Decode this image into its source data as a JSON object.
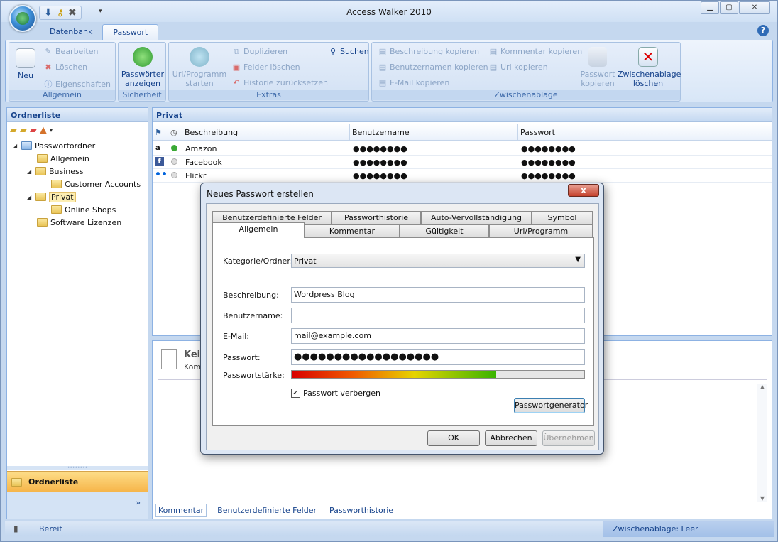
{
  "window": {
    "title": "Access Walker 2010"
  },
  "ribbon": {
    "tabs": [
      "Datenbank",
      "Passwort"
    ],
    "help": "?",
    "allgemein": {
      "neu": "Neu",
      "bearbeiten": "Bearbeiten",
      "loeschen": "Löschen",
      "eigenschaften": "Eigenschaften",
      "caption": "Allgemein"
    },
    "sicherheit": {
      "show_pw": "Passwörter anzeigen",
      "caption": "Sicherheit"
    },
    "extras": {
      "url_start": "Url/Programm starten",
      "duplizieren": "Duplizieren",
      "felder_loeschen": "Felder löschen",
      "historie": "Historie zurücksetzen",
      "suchen": "Suchen",
      "caption": "Extras"
    },
    "zwischenablage": {
      "beschreibung": "Beschreibung kopieren",
      "benutzer": "Benutzernamen kopieren",
      "email": "E-Mail kopieren",
      "kommentar": "Kommentar kopieren",
      "url": "Url kopieren",
      "pw_kopieren": "Passwort kopieren",
      "zw_loeschen": "Zwischenablage löschen",
      "caption": "Zwischenablage"
    }
  },
  "sidebar": {
    "title": "Ordnerliste",
    "tree": [
      "Passwortordner",
      "Allgemein",
      "Business",
      "Customer Accounts",
      "Privat",
      "Online Shops",
      "Software Lizenzen"
    ],
    "nav_button": "Ordnerliste",
    "chevron": "»"
  },
  "grid": {
    "title": "Privat",
    "columns": [
      "Beschreibung",
      "Benutzername",
      "Passwort"
    ],
    "rows": [
      {
        "name": "Amazon",
        "user": "●●●●●●●●",
        "pw": "●●●●●●●●",
        "icon": "a"
      },
      {
        "name": "Facebook",
        "user": "●●●●●●●●",
        "pw": "●●●●●●●●",
        "icon": "f"
      },
      {
        "name": "Flickr",
        "user": "●●●●●●●●",
        "pw": "●●●●●●●●",
        "icon": "••"
      }
    ]
  },
  "detail": {
    "head": "Kei",
    "sub": "Kom",
    "tabs": [
      "Kommentar",
      "Benutzerdefinierte Felder",
      "Passworthistorie"
    ]
  },
  "status": {
    "left": "Bereit",
    "right": "Zwischenablage: Leer"
  },
  "dialog": {
    "title": "Neues Passwort erstellen",
    "close": "x",
    "tabs_back": [
      "Benutzerdefinierte Felder",
      "Passworthistorie",
      "Auto-Vervollständigung",
      "Symbol"
    ],
    "tabs_front": [
      "Allgemein",
      "Kommentar",
      "Gültigkeit",
      "Url/Programm"
    ],
    "fields": {
      "kategorie_label": "Kategorie/Ordner:",
      "kategorie": "Privat",
      "beschreibung_label": "Beschreibung:",
      "beschreibung": "Wordpress Blog",
      "benutzer_label": "Benutzername:",
      "benutzer": "",
      "email_label": "E-Mail:",
      "email": "mail@example.com",
      "pw_label": "Passwort:",
      "pw": "●●●●●●●●●●●●●●●●●●",
      "staerke_label": "Passwortstärke:",
      "staerke": 0.7,
      "verbergen": "Passwort verbergen",
      "verbergen_checked": true
    },
    "generator": "Passwortgenerator",
    "ok": "OK",
    "abbrechen": "Abbrechen",
    "uebernehmen": "Übernehmen"
  }
}
